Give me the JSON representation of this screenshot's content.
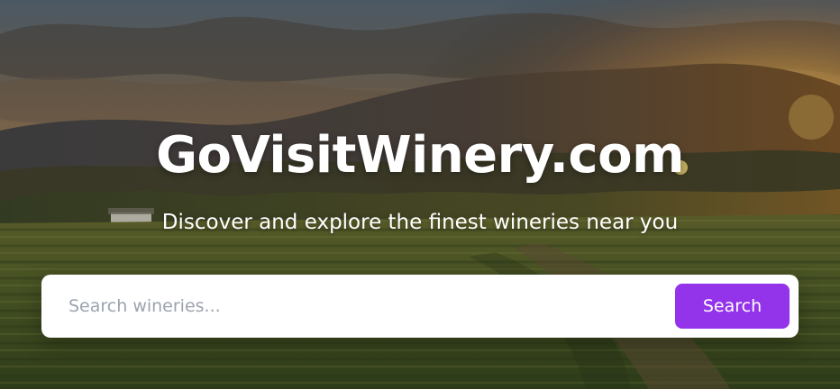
{
  "hero": {
    "title": "GoVisitWinery.com",
    "tagline": "Discover and explore the finest wineries near you",
    "background_image": "vineyard-sunset-landscape"
  },
  "search": {
    "placeholder": "Search wineries...",
    "value": "",
    "button_label": "Search"
  },
  "colors": {
    "accent": "#9333ea",
    "title_text": "#ffffff",
    "placeholder_text": "#9ca3af",
    "search_panel": "#ffffff"
  }
}
